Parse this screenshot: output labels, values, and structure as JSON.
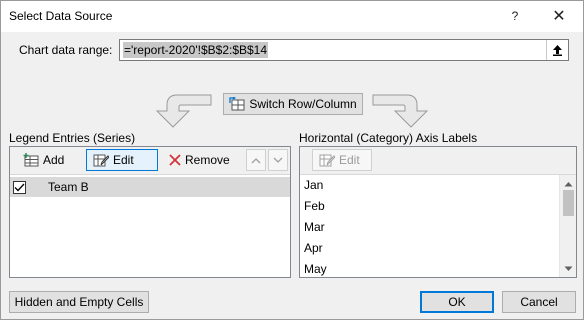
{
  "window": {
    "title": "Select Data Source",
    "help_glyph": "?",
    "close_glyph": "✕"
  },
  "range": {
    "label": "Chart data range:",
    "value": "='report-2020'!$B$2:$B$14"
  },
  "switch_button": {
    "label": "Switch Row/Column"
  },
  "legend": {
    "label": "Legend Entries (Series)",
    "add_label": "Add",
    "edit_label": "Edit",
    "remove_label": "Remove",
    "series": [
      {
        "name": "Team B",
        "checked": true
      }
    ]
  },
  "axis": {
    "label": "Horizontal (Category) Axis Labels",
    "edit_label": "Edit",
    "items": [
      "Jan",
      "Feb",
      "Mar",
      "Apr",
      "May"
    ]
  },
  "footer": {
    "hidden_cells_label": "Hidden and Empty Cells",
    "ok_label": "OK",
    "cancel_label": "Cancel"
  },
  "colors": {
    "accent": "#0078d7",
    "remove_icon": "#d13438",
    "selection": "#d9d9d9"
  }
}
